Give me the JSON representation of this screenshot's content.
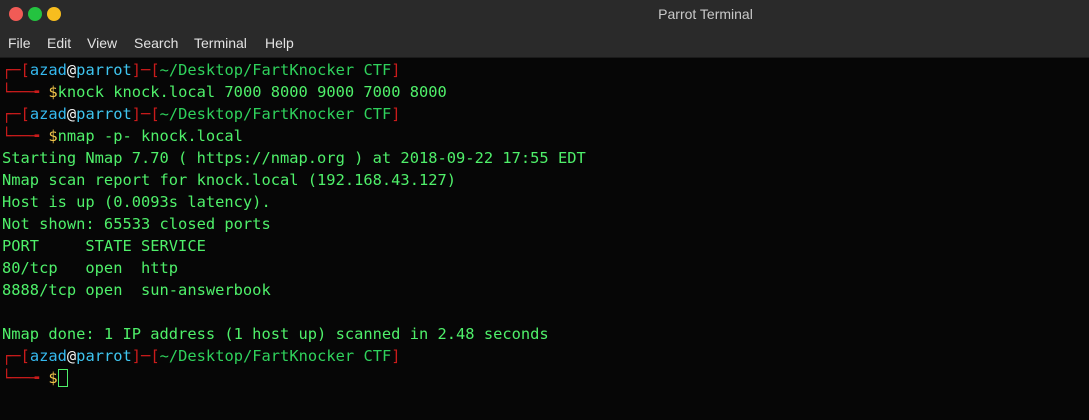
{
  "window": {
    "title": "Parrot Terminal",
    "colors": {
      "close": "#f15b56",
      "minimize": "#24c340",
      "maximize": "#f7bd1e"
    }
  },
  "menu": [
    "File",
    "Edit",
    "View",
    "Search",
    "Terminal",
    "Help"
  ],
  "prompt": {
    "user": "azad",
    "at": "@",
    "host": "parrot",
    "path": "~/Desktop/FartKnocker CTF",
    "top_prefix": "┌─[",
    "sep": "]─[",
    "close": "]",
    "bottom_prefix": "└──╼ ",
    "dollar": "$"
  },
  "commands": [
    "knock knock.local 7000 8000 9000 7000 8000",
    "nmap -p- knock.local"
  ],
  "output": [
    "Starting Nmap 7.70 ( https://nmap.org ) at 2018-09-22 17:55 EDT",
    "Nmap scan report for knock.local (192.168.43.127)",
    "Host is up (0.0093s latency).",
    "Not shown: 65533 closed ports",
    "PORT     STATE SERVICE",
    "80/tcp   open  http",
    "8888/tcp open  sun-answerbook",
    "",
    "Nmap done: 1 IP address (1 host up) scanned in 2.48 seconds"
  ],
  "colors": {
    "text": "#4ff06a",
    "bracket": "#c91b1b",
    "user": "#35b9ef",
    "dollar": "#f2c54a",
    "background": "#060606"
  }
}
